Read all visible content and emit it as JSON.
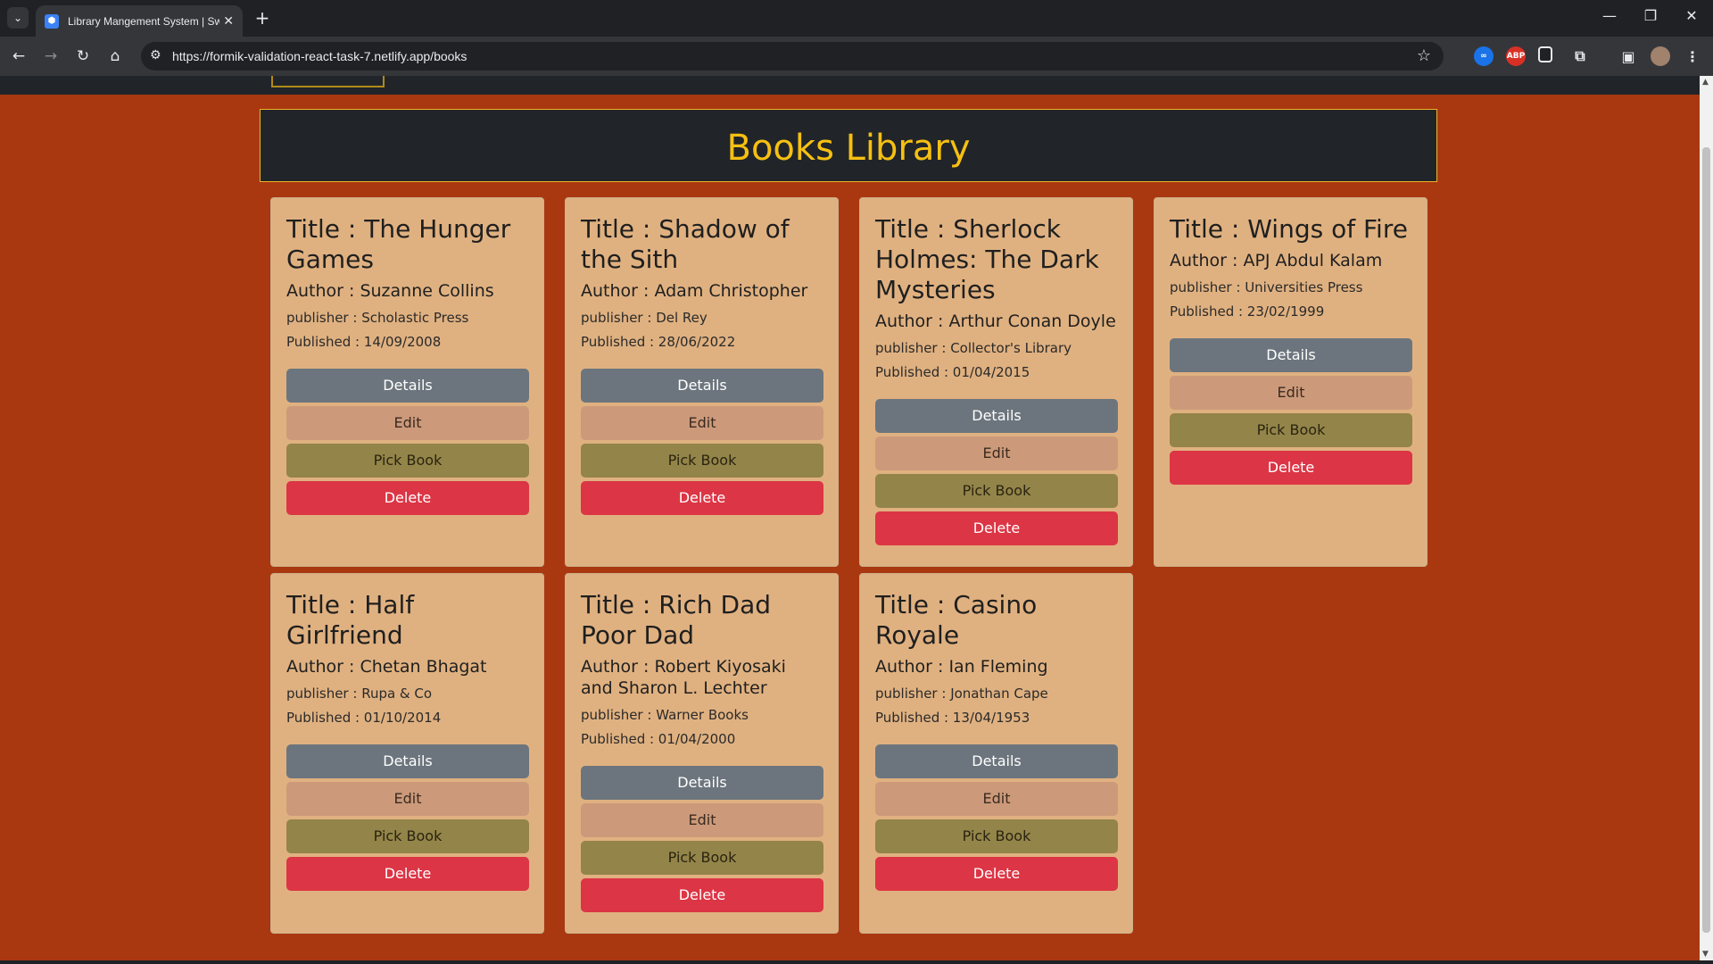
{
  "browser": {
    "tab_title": "Library Mangement System | Sw",
    "url": "https://formik-validation-react-task-7.netlify.app/books",
    "extensions": [
      "ABP"
    ]
  },
  "page": {
    "title": "Books Library"
  },
  "labels": {
    "details": "Details",
    "edit": "Edit",
    "pick": "Pick Book",
    "delete": "Delete"
  },
  "books": [
    {
      "title": "Title : The Hunger Games",
      "author": "Author : Suzanne Collins",
      "publisher": "publisher : Scholastic Press",
      "published": "Published : 14/09/2008"
    },
    {
      "title": "Title : Shadow of the Sith",
      "author": "Author : Adam Christopher",
      "publisher": "publisher : Del Rey",
      "published": "Published : 28/06/2022"
    },
    {
      "title": "Title : Sherlock Holmes: The Dark Mysteries",
      "author": "Author : Arthur Conan Doyle",
      "publisher": "publisher : Collector's Library",
      "published": "Published : 01/04/2015"
    },
    {
      "title": "Title : Wings of Fire",
      "author": "Author : APJ Abdul Kalam",
      "publisher": "publisher : Universities Press",
      "published": "Published : 23/02/1999"
    },
    {
      "title": "Title : Half Girlfriend",
      "author": "Author : Chetan Bhagat",
      "publisher": "publisher : Rupa & Co",
      "published": "Published : 01/10/2014"
    },
    {
      "title": "Title : Rich Dad Poor Dad",
      "author": "Author : Robert Kiyosaki and Sharon L. Lechter",
      "publisher": "publisher : Warner Books",
      "published": "Published : 01/04/2000"
    },
    {
      "title": "Title : Casino Royale",
      "author": "Author : Ian Fleming",
      "publisher": "publisher : Jonathan Cape",
      "published": "Published : 13/04/1953"
    }
  ]
}
